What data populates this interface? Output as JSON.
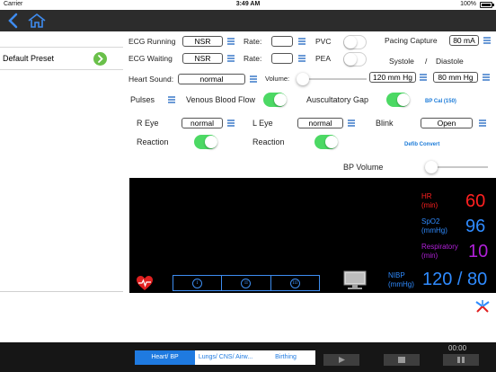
{
  "status_bar": {
    "carrier": "Carrier",
    "time": "3:49 AM",
    "battery": "100%",
    "battery_level": 1.0
  },
  "nav": {
    "back_icon": "chevron-left-icon",
    "home_icon": "home-icon"
  },
  "sidebar": {
    "preset_label": "Default Preset",
    "preset_action_icon": "chevron-right-icon"
  },
  "ecg": {
    "running_label": "ECG Running",
    "running_value": "NSR",
    "waiting_label": "ECG Waiting",
    "waiting_value": "NSR",
    "rate_label_1": "Rate:",
    "rate_label_2": "Rate:",
    "rate_value_1": "",
    "rate_value_2": "",
    "pvc_label": "PVC",
    "pvc_on": false,
    "pea_label": "PEA",
    "pea_on": false
  },
  "pacing": {
    "label": "Pacing Capture",
    "value": "80 mA"
  },
  "bp_header": {
    "systole": "Systole",
    "slash": "/",
    "diastole": "Diastole"
  },
  "heart_sound": {
    "label": "Heart Sound:",
    "value": "normal",
    "volume_label": "Volume:",
    "volume_level": 0.0
  },
  "bp": {
    "systole_value": "120 mm Hg",
    "diastole_value": "80 mm Hg",
    "cal_link": "BP Cal (150)"
  },
  "pulses": {
    "label": "Pulses",
    "venous_label": "Venous Blood Flow",
    "venous_on": true,
    "auscultatory_label": "Auscultatory Gap",
    "auscultatory_on": true
  },
  "eyes": {
    "r_eye_label": "R Eye",
    "r_eye_value": "normal",
    "l_eye_label": "L Eye",
    "l_eye_value": "normal",
    "blink_label": "Blink",
    "blink_value": "Open",
    "reaction_label_1": "Reaction",
    "reaction_on_1": true,
    "reaction_label_2": "Reaction",
    "reaction_on_2": true,
    "defib_link": "Defib Convert"
  },
  "bp_volume": {
    "label": "BP Volume",
    "level": 0.0
  },
  "monitor": {
    "hr_label": "HR\n(min)",
    "hr_value": "60",
    "spo2_label": "SpO2\n(mmHg)",
    "spo2_value": "96",
    "resp_label": "Respiratory\n(min)",
    "resp_value": "10",
    "nibp_label": "NIBP\n(mmHg)",
    "nibp_value": "120 / 80",
    "tab_labels": [
      "I",
      "II",
      "III"
    ],
    "colors": {
      "hr": "#ff2020",
      "spo2": "#2f8bff",
      "resp": "#b020d8",
      "nibp": "#2f8bff"
    }
  },
  "bottom": {
    "tabs": [
      "Heart/ BP",
      "Lungs/ CNS/ Airw...",
      "Birthing"
    ],
    "active_tab": 0,
    "timer": "00:00",
    "controls": [
      "play-icon",
      "stop-icon",
      "pause-icon"
    ]
  }
}
